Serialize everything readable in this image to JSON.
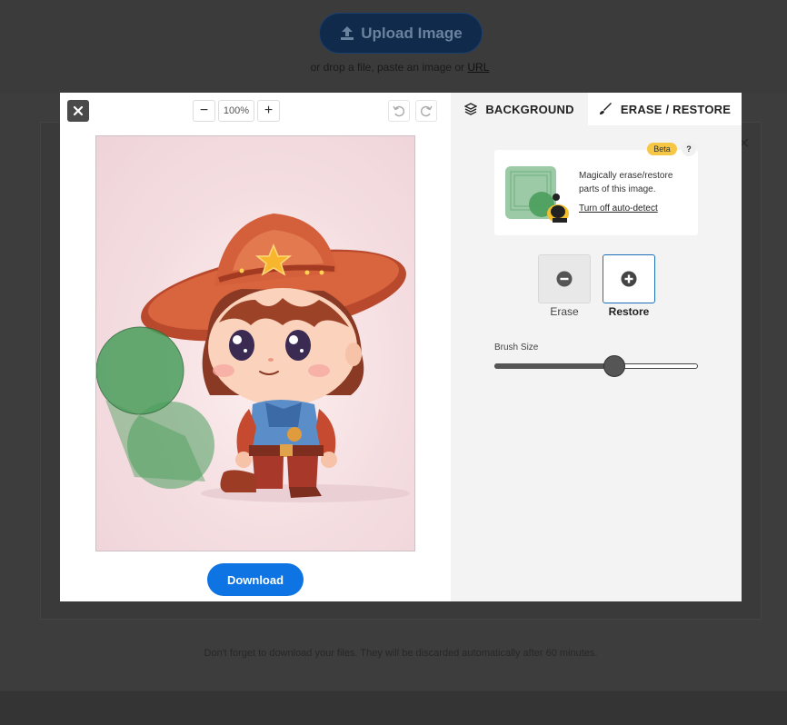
{
  "background_page": {
    "upload_label": "Upload Image",
    "drop_prefix": "or drop a file, paste an image or ",
    "drop_link": "URL",
    "footer_note": "Don't forget to download your files. They will be discarded automatically after 60 minutes."
  },
  "toolbar": {
    "zoom_out": "−",
    "zoom_value": "100%",
    "zoom_in": "+"
  },
  "tabs": [
    {
      "label": "BACKGROUND",
      "icon": "layers-icon",
      "active": false
    },
    {
      "label": "ERASE / RESTORE",
      "icon": "brush-icon",
      "active": true
    }
  ],
  "info": {
    "badge": "Beta",
    "help": "?",
    "text": "Magically erase/restore parts of this image.",
    "link": "Turn off auto-detect"
  },
  "modes": {
    "erase_label": "Erase",
    "restore_label": "Restore",
    "selected": "Restore"
  },
  "brush": {
    "label": "Brush Size",
    "value_fraction": 0.59
  },
  "download_label": "Download",
  "colors": {
    "accent_blue": "#0e74e3",
    "brush_green": "#4a9e5c",
    "beta_yellow": "#f5c744"
  }
}
